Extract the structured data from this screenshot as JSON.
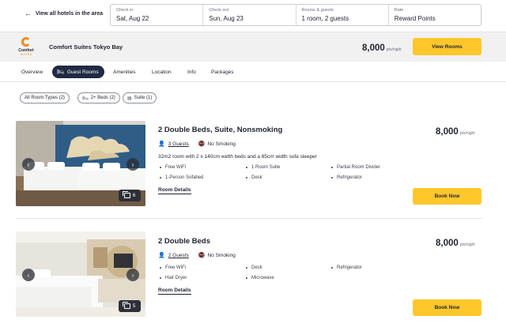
{
  "search": {
    "back_label": "View all hotels in the area",
    "fields": [
      {
        "label": "Check in",
        "value": "Sat, Aug 22"
      },
      {
        "label": "Check out",
        "value": "Sun, Aug 23"
      },
      {
        "label": "Rooms & guests",
        "value": "1 room, 2 guests"
      },
      {
        "label": "Rate",
        "value": "Reward Points"
      }
    ]
  },
  "hotel": {
    "logo_text": "Comfort",
    "logo_sub": "SUITES",
    "name": "Comfort Suites Tokyo Bay",
    "price": "8,000",
    "price_unit": "pts/night",
    "view_rooms_label": "View Rooms"
  },
  "tabs": [
    {
      "label": "Overview",
      "active": false
    },
    {
      "label": "Guest Rooms",
      "active": true
    },
    {
      "label": "Amenities",
      "active": false
    },
    {
      "label": "Location",
      "active": false
    },
    {
      "label": "Info",
      "active": false
    },
    {
      "label": "Packages",
      "active": false
    }
  ],
  "filters": [
    {
      "label": "All Room Types (2)",
      "icon": null
    },
    {
      "label": "2+ Beds (2)",
      "icon": "bed-icon"
    },
    {
      "label": "Suite (1)",
      "icon": "suite-icon"
    }
  ],
  "rooms": [
    {
      "title": "2 Double Beds, Suite, Nonsmoking",
      "price": "8,000",
      "price_unit": "pts/night",
      "guests": "3 Guests",
      "smoking": "No Smoking",
      "description": "32m2 room with 2 x 140cm width beds and a 85cm width sofa sleeper",
      "amenities": [
        "Free WiFi",
        "1 Room Suite",
        "Partial Room Divider",
        "1-Person Sofabed",
        "Desk",
        "Refrigerator"
      ],
      "details_label": "Room Details",
      "book_label": "Book Now",
      "photo_count": "6"
    },
    {
      "title": "2 Double Beds",
      "price": "8,000",
      "price_unit": "pts/night",
      "guests": "2 Guests",
      "smoking": "No Smoking",
      "description": "",
      "amenities": [
        "Free WiFi",
        "Desk",
        "Refrigerator",
        "Hair Dryer",
        "Microwave"
      ],
      "details_label": "Room Details",
      "book_label": "Book Now",
      "photo_count": "5"
    }
  ],
  "colors": {
    "accent_yellow": "#ffc72c",
    "active_tab": "#1f2a44",
    "brand_orange": "#f08a24",
    "header_bg": "#f1f1f1"
  }
}
